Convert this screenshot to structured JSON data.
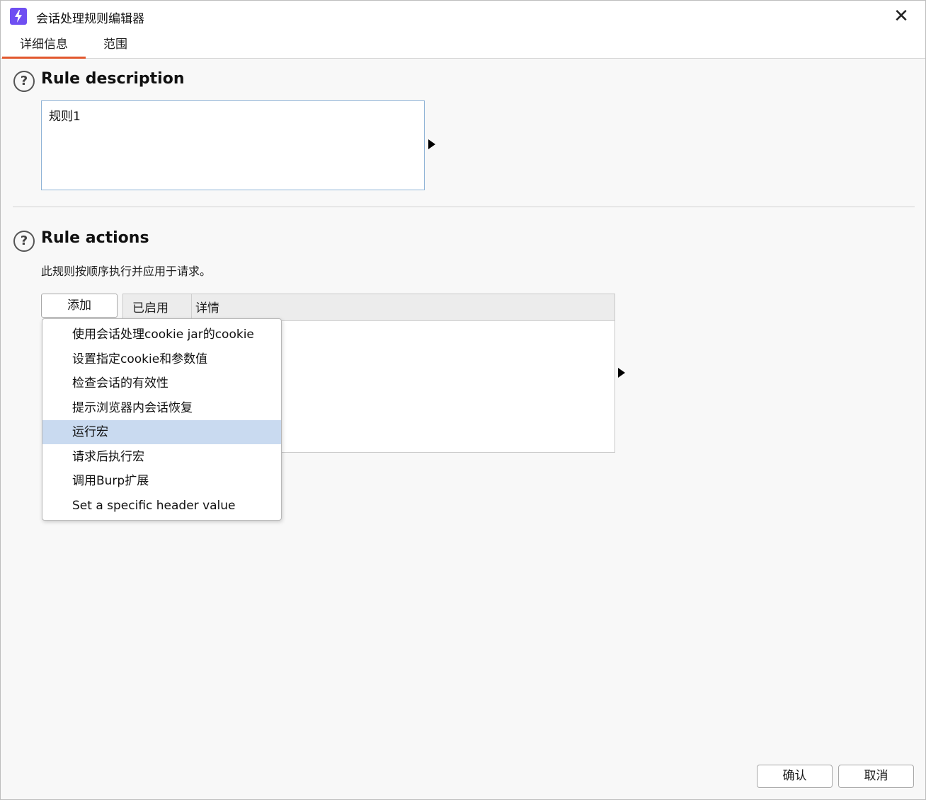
{
  "window": {
    "title": "会话处理规则编辑器",
    "close_glyph": "✕"
  },
  "tabs": [
    {
      "label": "详细信息",
      "active": true
    },
    {
      "label": "范围",
      "active": false
    }
  ],
  "rule_description": {
    "heading": "Rule description",
    "help_glyph": "?",
    "value": "规则1"
  },
  "rule_actions": {
    "heading": "Rule actions",
    "help_glyph": "?",
    "subtext": "此规则按顺序执行并应用于请求。",
    "add_label": "添加",
    "columns": [
      "已启用",
      "详情"
    ]
  },
  "add_menu": {
    "items": [
      "使用会话处理cookie jar的cookie",
      "设置指定cookie和参数值",
      "检查会话的有效性",
      "提示浏览器内会话恢复",
      "运行宏",
      "请求后执行宏",
      "调用Burp扩展",
      "Set a specific header value"
    ],
    "highlighted_index": 4
  },
  "footer": {
    "ok_label": "确认",
    "cancel_label": "取消"
  },
  "colors": {
    "accent_tab": "#e2582e",
    "app_icon": "#6f4ff2",
    "menu_highlight": "#c9daf0"
  },
  "icons": {
    "app": "burp-lightning-icon",
    "close": "close-icon",
    "help": "help-circle-icon"
  }
}
